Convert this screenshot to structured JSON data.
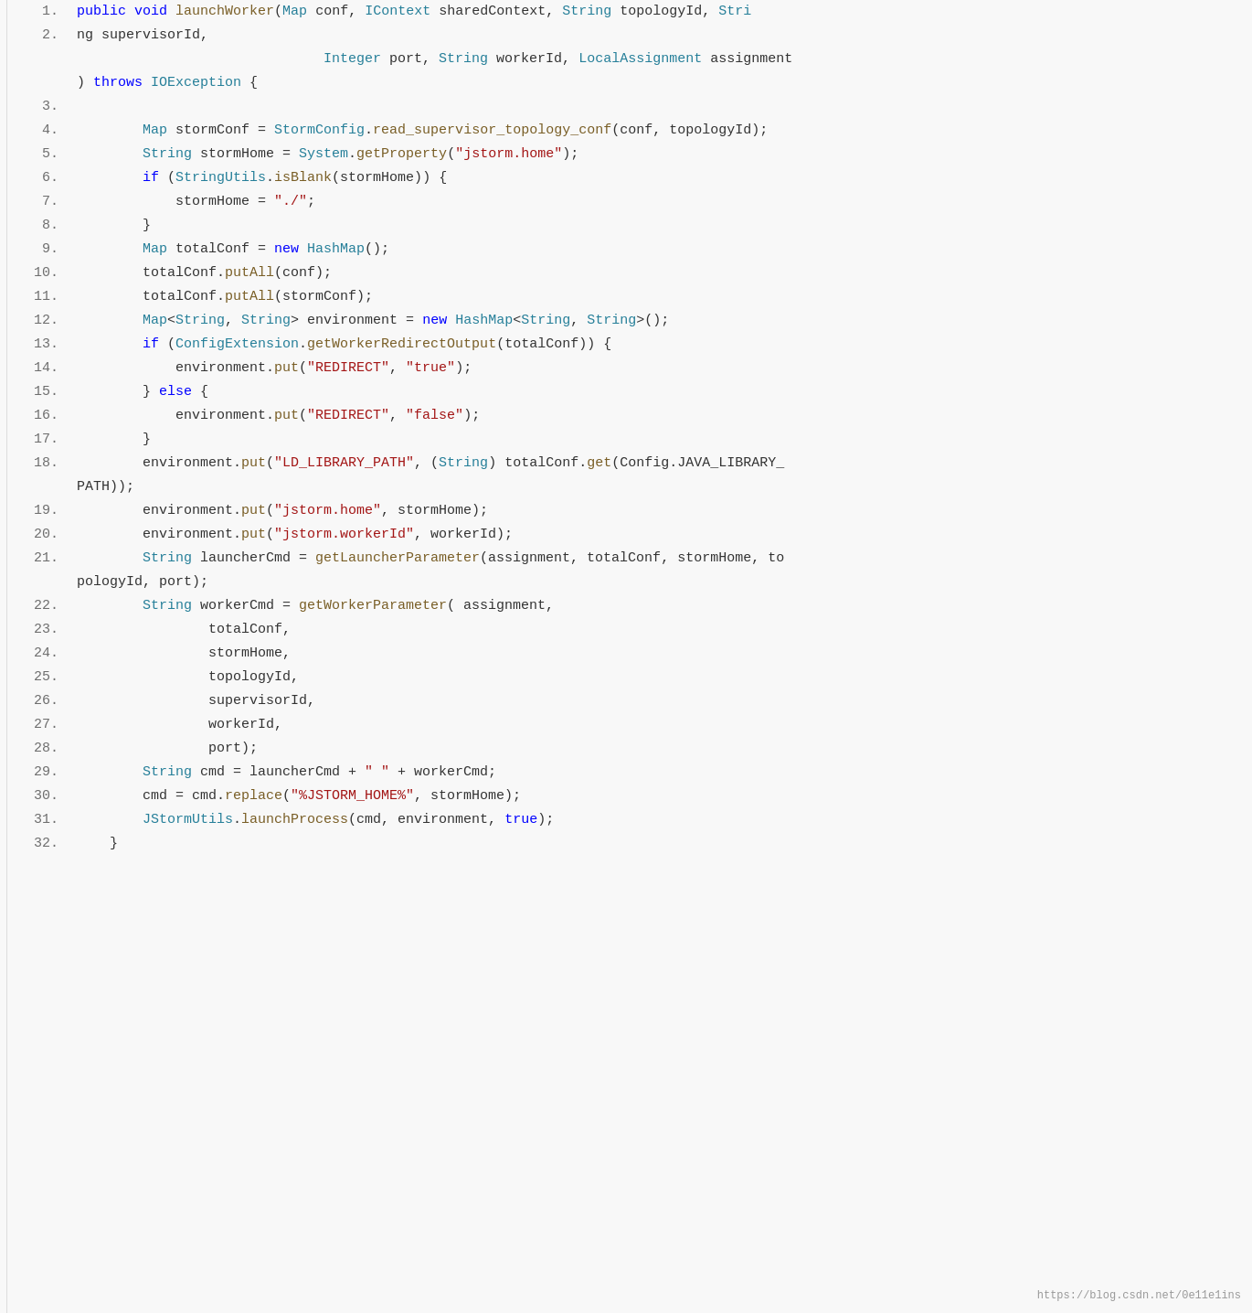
{
  "watermark": "https://blog.csdn.net/0e11e1ins",
  "lines": [
    {
      "num": "1.",
      "tokens": [
        {
          "t": "kw",
          "v": "public"
        },
        {
          "t": "plain",
          "v": " "
        },
        {
          "t": "kw",
          "v": "void"
        },
        {
          "t": "plain",
          "v": " "
        },
        {
          "t": "method",
          "v": "launchWorker"
        },
        {
          "t": "plain",
          "v": "("
        },
        {
          "t": "type",
          "v": "Map"
        },
        {
          "t": "plain",
          "v": " conf, "
        },
        {
          "t": "type",
          "v": "IContext"
        },
        {
          "t": "plain",
          "v": " sharedContext, "
        },
        {
          "t": "type",
          "v": "String"
        },
        {
          "t": "plain",
          "v": " topologyId, "
        },
        {
          "t": "type",
          "v": "Stri"
        },
        {
          "t": "plain",
          "v": ""
        }
      ]
    },
    {
      "num": "2.",
      "tokens": [
        {
          "t": "plain",
          "v": "ng supervisorId,"
        },
        {
          "t": "plain",
          "v": ""
        }
      ]
    },
    {
      "num": "",
      "tokens": [
        {
          "t": "plain",
          "v": "                              "
        },
        {
          "t": "type",
          "v": "Integer"
        },
        {
          "t": "plain",
          "v": " port, "
        },
        {
          "t": "type",
          "v": "String"
        },
        {
          "t": "plain",
          "v": " workerId, "
        },
        {
          "t": "type",
          "v": "LocalAssignment"
        },
        {
          "t": "plain",
          "v": " assignment"
        }
      ]
    },
    {
      "num": "",
      "tokens": [
        {
          "t": "plain",
          "v": ") "
        },
        {
          "t": "kw",
          "v": "throws"
        },
        {
          "t": "plain",
          "v": " "
        },
        {
          "t": "type",
          "v": "IOException"
        },
        {
          "t": "plain",
          "v": " {"
        }
      ]
    },
    {
      "num": "3.",
      "tokens": [
        {
          "t": "plain",
          "v": ""
        }
      ]
    },
    {
      "num": "4.",
      "tokens": [
        {
          "t": "plain",
          "v": "        "
        },
        {
          "t": "type",
          "v": "Map"
        },
        {
          "t": "plain",
          "v": " stormConf = "
        },
        {
          "t": "type",
          "v": "StormConfig"
        },
        {
          "t": "plain",
          "v": "."
        },
        {
          "t": "method",
          "v": "read_supervisor_topology_conf"
        },
        {
          "t": "plain",
          "v": "(conf, topologyId);"
        }
      ]
    },
    {
      "num": "5.",
      "tokens": [
        {
          "t": "plain",
          "v": "        "
        },
        {
          "t": "type",
          "v": "String"
        },
        {
          "t": "plain",
          "v": " stormHome = "
        },
        {
          "t": "type",
          "v": "System"
        },
        {
          "t": "plain",
          "v": "."
        },
        {
          "t": "method",
          "v": "getProperty"
        },
        {
          "t": "plain",
          "v": "("
        },
        {
          "t": "str",
          "v": "\"jstorm.home\""
        },
        {
          "t": "plain",
          "v": ");"
        }
      ]
    },
    {
      "num": "6.",
      "tokens": [
        {
          "t": "plain",
          "v": "        "
        },
        {
          "t": "kw",
          "v": "if"
        },
        {
          "t": "plain",
          "v": " ("
        },
        {
          "t": "type",
          "v": "StringUtils"
        },
        {
          "t": "plain",
          "v": "."
        },
        {
          "t": "method",
          "v": "isBlank"
        },
        {
          "t": "plain",
          "v": "(stormHome)) {"
        }
      ]
    },
    {
      "num": "7.",
      "tokens": [
        {
          "t": "plain",
          "v": "            stormHome = "
        },
        {
          "t": "str",
          "v": "\"./\""
        },
        {
          "t": "plain",
          "v": ";"
        }
      ]
    },
    {
      "num": "8.",
      "tokens": [
        {
          "t": "plain",
          "v": "        }"
        }
      ]
    },
    {
      "num": "9.",
      "tokens": [
        {
          "t": "plain",
          "v": "        "
        },
        {
          "t": "type",
          "v": "Map"
        },
        {
          "t": "plain",
          "v": " totalConf = "
        },
        {
          "t": "kw",
          "v": "new"
        },
        {
          "t": "plain",
          "v": " "
        },
        {
          "t": "type",
          "v": "HashMap"
        },
        {
          "t": "plain",
          "v": "();"
        }
      ]
    },
    {
      "num": "10.",
      "tokens": [
        {
          "t": "plain",
          "v": "        totalConf."
        },
        {
          "t": "method",
          "v": "putAll"
        },
        {
          "t": "plain",
          "v": "(conf);"
        }
      ]
    },
    {
      "num": "11.",
      "tokens": [
        {
          "t": "plain",
          "v": "        totalConf."
        },
        {
          "t": "method",
          "v": "putAll"
        },
        {
          "t": "plain",
          "v": "(stormConf);"
        }
      ]
    },
    {
      "num": "12.",
      "tokens": [
        {
          "t": "plain",
          "v": "        "
        },
        {
          "t": "type",
          "v": "Map"
        },
        {
          "t": "plain",
          "v": "<"
        },
        {
          "t": "type",
          "v": "String"
        },
        {
          "t": "plain",
          "v": ", "
        },
        {
          "t": "type",
          "v": "String"
        },
        {
          "t": "plain",
          "v": "> environment = "
        },
        {
          "t": "kw",
          "v": "new"
        },
        {
          "t": "plain",
          "v": " "
        },
        {
          "t": "type",
          "v": "HashMap"
        },
        {
          "t": "plain",
          "v": "<"
        },
        {
          "t": "type",
          "v": "String"
        },
        {
          "t": "plain",
          "v": ", "
        },
        {
          "t": "type",
          "v": "String"
        },
        {
          "t": "plain",
          "v": ">();"
        }
      ]
    },
    {
      "num": "13.",
      "tokens": [
        {
          "t": "plain",
          "v": "        "
        },
        {
          "t": "kw",
          "v": "if"
        },
        {
          "t": "plain",
          "v": " ("
        },
        {
          "t": "type",
          "v": "ConfigExtension"
        },
        {
          "t": "plain",
          "v": "."
        },
        {
          "t": "method",
          "v": "getWorkerRedirectOutput"
        },
        {
          "t": "plain",
          "v": "(totalConf)) {"
        }
      ]
    },
    {
      "num": "14.",
      "tokens": [
        {
          "t": "plain",
          "v": "            environment."
        },
        {
          "t": "method",
          "v": "put"
        },
        {
          "t": "plain",
          "v": "("
        },
        {
          "t": "str",
          "v": "\"REDIRECT\""
        },
        {
          "t": "plain",
          "v": ", "
        },
        {
          "t": "str",
          "v": "\"true\""
        },
        {
          "t": "plain",
          "v": ");"
        }
      ]
    },
    {
      "num": "15.",
      "tokens": [
        {
          "t": "plain",
          "v": "        } "
        },
        {
          "t": "kw",
          "v": "else"
        },
        {
          "t": "plain",
          "v": " {"
        }
      ]
    },
    {
      "num": "16.",
      "tokens": [
        {
          "t": "plain",
          "v": "            environment."
        },
        {
          "t": "method",
          "v": "put"
        },
        {
          "t": "plain",
          "v": "("
        },
        {
          "t": "str",
          "v": "\"REDIRECT\""
        },
        {
          "t": "plain",
          "v": ", "
        },
        {
          "t": "str",
          "v": "\"false\""
        },
        {
          "t": "plain",
          "v": ");"
        }
      ]
    },
    {
      "num": "17.",
      "tokens": [
        {
          "t": "plain",
          "v": "        }"
        }
      ]
    },
    {
      "num": "18.",
      "tokens": [
        {
          "t": "plain",
          "v": "        environment."
        },
        {
          "t": "method",
          "v": "put"
        },
        {
          "t": "plain",
          "v": "("
        },
        {
          "t": "str",
          "v": "\"LD_LIBRARY_PATH\""
        },
        {
          "t": "plain",
          "v": ", ("
        },
        {
          "t": "type",
          "v": "String"
        },
        {
          "t": "plain",
          "v": ") totalConf."
        },
        {
          "t": "method",
          "v": "get"
        },
        {
          "t": "plain",
          "v": "(Config.JAVA_LIBRARY_"
        }
      ]
    },
    {
      "num": "",
      "tokens": [
        {
          "t": "plain",
          "v": "PATH));"
        }
      ]
    },
    {
      "num": "19.",
      "tokens": [
        {
          "t": "plain",
          "v": "        environment."
        },
        {
          "t": "method",
          "v": "put"
        },
        {
          "t": "plain",
          "v": "("
        },
        {
          "t": "str",
          "v": "\"jstorm.home\""
        },
        {
          "t": "plain",
          "v": ", stormHome);"
        }
      ]
    },
    {
      "num": "20.",
      "tokens": [
        {
          "t": "plain",
          "v": "        environment."
        },
        {
          "t": "method",
          "v": "put"
        },
        {
          "t": "plain",
          "v": "("
        },
        {
          "t": "str",
          "v": "\"jstorm.workerId\""
        },
        {
          "t": "plain",
          "v": ", workerId);"
        }
      ]
    },
    {
      "num": "21.",
      "tokens": [
        {
          "t": "plain",
          "v": "        "
        },
        {
          "t": "type",
          "v": "String"
        },
        {
          "t": "plain",
          "v": " launcherCmd = "
        },
        {
          "t": "method",
          "v": "getLauncherParameter"
        },
        {
          "t": "plain",
          "v": "(assignment, totalConf, stormHome, to"
        }
      ]
    },
    {
      "num": "",
      "tokens": [
        {
          "t": "plain",
          "v": "pologyId, port);"
        }
      ]
    },
    {
      "num": "22.",
      "tokens": [
        {
          "t": "plain",
          "v": "        "
        },
        {
          "t": "type",
          "v": "String"
        },
        {
          "t": "plain",
          "v": " workerCmd = "
        },
        {
          "t": "method",
          "v": "getWorkerParameter"
        },
        {
          "t": "plain",
          "v": "( assignment,"
        }
      ]
    },
    {
      "num": "23.",
      "tokens": [
        {
          "t": "plain",
          "v": "                totalConf,"
        }
      ]
    },
    {
      "num": "24.",
      "tokens": [
        {
          "t": "plain",
          "v": "                stormHome,"
        }
      ]
    },
    {
      "num": "25.",
      "tokens": [
        {
          "t": "plain",
          "v": "                topologyId,"
        }
      ]
    },
    {
      "num": "26.",
      "tokens": [
        {
          "t": "plain",
          "v": "                supervisorId,"
        }
      ]
    },
    {
      "num": "27.",
      "tokens": [
        {
          "t": "plain",
          "v": "                workerId,"
        }
      ]
    },
    {
      "num": "28.",
      "tokens": [
        {
          "t": "plain",
          "v": "                port);"
        }
      ]
    },
    {
      "num": "29.",
      "tokens": [
        {
          "t": "plain",
          "v": "        "
        },
        {
          "t": "type",
          "v": "String"
        },
        {
          "t": "plain",
          "v": " cmd = launcherCmd + "
        },
        {
          "t": "str",
          "v": "\" \""
        },
        {
          "t": "plain",
          "v": " + workerCmd;"
        }
      ]
    },
    {
      "num": "30.",
      "tokens": [
        {
          "t": "plain",
          "v": "        cmd = cmd."
        },
        {
          "t": "method",
          "v": "replace"
        },
        {
          "t": "plain",
          "v": "("
        },
        {
          "t": "str",
          "v": "\"%JSTORM_HOME%\""
        },
        {
          "t": "plain",
          "v": ", stormHome);"
        }
      ]
    },
    {
      "num": "31.",
      "tokens": [
        {
          "t": "plain",
          "v": "        "
        },
        {
          "t": "type",
          "v": "JStormUtils"
        },
        {
          "t": "plain",
          "v": "."
        },
        {
          "t": "method",
          "v": "launchProcess"
        },
        {
          "t": "plain",
          "v": "(cmd, environment, "
        },
        {
          "t": "kw",
          "v": "true"
        },
        {
          "t": "plain",
          "v": ");"
        }
      ]
    },
    {
      "num": "32.",
      "tokens": [
        {
          "t": "plain",
          "v": "    }"
        }
      ]
    }
  ]
}
